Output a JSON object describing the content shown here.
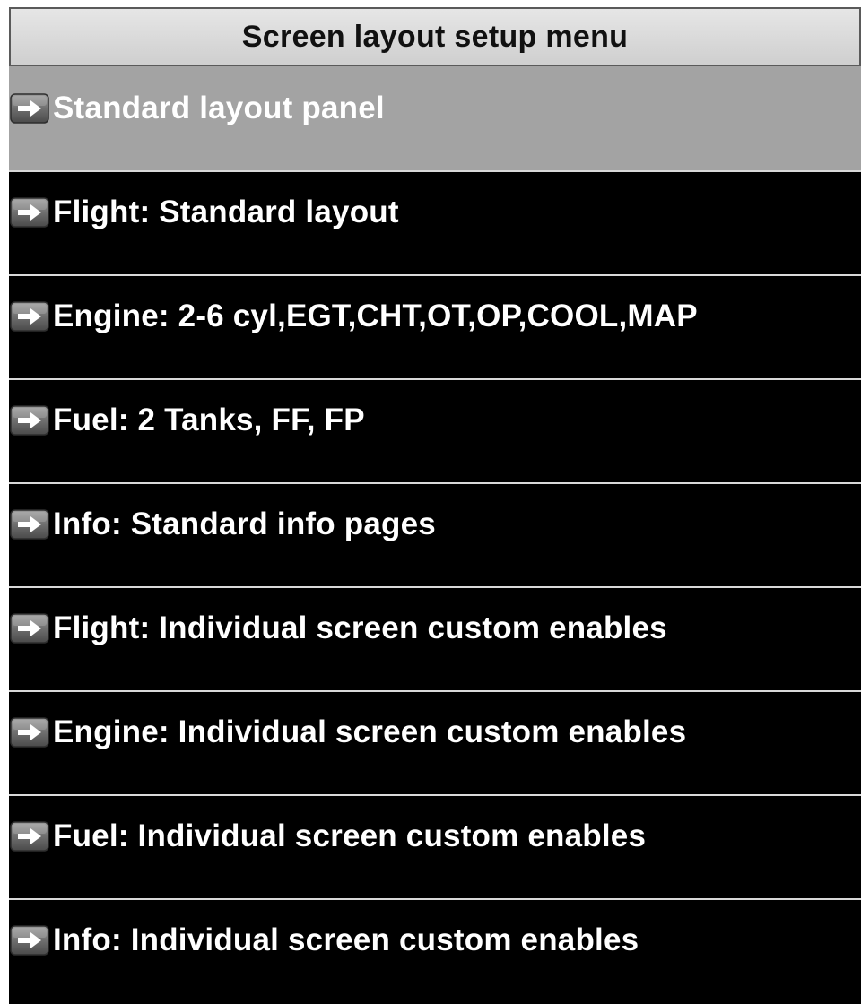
{
  "menu": {
    "title": "Screen layout setup menu",
    "selected_index": 0,
    "items": [
      {
        "label": "Standard layout panel",
        "icon": "arrow-right-icon"
      },
      {
        "label": "Flight: Standard layout",
        "icon": "arrow-right-icon"
      },
      {
        "label": "Engine: 2-6 cyl,EGT,CHT,OT,OP,COOL,MAP",
        "icon": "arrow-right-icon"
      },
      {
        "label": "Fuel: 2 Tanks, FF, FP",
        "icon": "arrow-right-icon"
      },
      {
        "label": "Info: Standard info pages",
        "icon": "arrow-right-icon"
      },
      {
        "label": "Flight: Individual screen custom enables",
        "icon": "arrow-right-icon"
      },
      {
        "label": "Engine: Individual screen custom enables",
        "icon": "arrow-right-icon"
      },
      {
        "label": "Fuel: Individual screen custom enables",
        "icon": "arrow-right-icon"
      },
      {
        "label": "Info: Individual screen custom enables",
        "icon": "arrow-right-icon"
      }
    ]
  },
  "colors": {
    "background": "#000000",
    "selected_row": "#a3a3a3",
    "title_bar": "#d9d9d9",
    "text": "#ffffff",
    "title_text": "#111111",
    "row_separator": "#d8d8d8"
  }
}
